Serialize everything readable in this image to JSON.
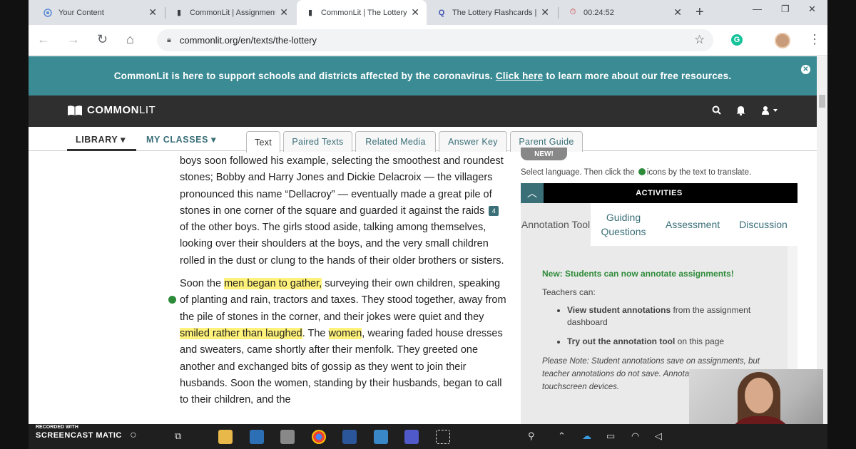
{
  "browser": {
    "tabs": [
      {
        "title": "Your Content",
        "icon": "circle-icon",
        "active": false
      },
      {
        "title": "CommonLit | Assignment",
        "icon": "book-icon",
        "active": false
      },
      {
        "title": "CommonLit | The Lottery",
        "icon": "book-icon",
        "active": true
      },
      {
        "title": "The Lottery Flashcards | Q",
        "icon": "quizlet-icon",
        "active": false
      },
      {
        "title": "00:24:52",
        "icon": "timer-icon",
        "active": false
      }
    ],
    "new_tab_glyph": "+",
    "url": "commonlit.org/en/texts/the-lottery"
  },
  "banner": {
    "before": "CommonLit is here to support schools and districts affected by the coronavirus.",
    "link": "Click here",
    "after": "to learn more about our free resources."
  },
  "header": {
    "logo_common": "COMMON",
    "logo_lit": "LIT"
  },
  "subnav": {
    "library": "LIBRARY",
    "my_classes": "MY CLASSES",
    "tabs": [
      "Text",
      "Paired Texts",
      "Related Media",
      "Answer Key",
      "Parent Guide"
    ]
  },
  "reading": {
    "p1_a": "boys soon followed his example, selecting the smoothest and roundest stones; Bobby and Harry Jones and Dickie Delacroix — the villagers pronounced this name “Dellacroy” — eventually made a great pile of stones in one corner of the square and guarded it against the raids",
    "p1_ref": "4",
    "p1_b": "of the other boys. The girls stood aside, talking among themselves, looking over their shoulders at the boys, and the very small children rolled in the dust or clung to the hands of their older brothers or sisters.",
    "p2_a": "Soon the",
    "p2_h1": "men began to gather,",
    "p2_b": "surveying their own children, speaking of planting and rain, tractors and taxes. They stood together, away from the pile of stones in the corner, and their jokes were quiet and they",
    "p2_h2": "smiled rather than laughed",
    "p2_c": ". The",
    "p2_h3": "women",
    "p2_d": ", wearing faded house dresses and sweaters, came shortly after their menfolk. They greeted one another and exchanged bits of gossip as they went to join their husbands. Soon the women, standing by their husbands, began to call to their children, and the"
  },
  "panel": {
    "new_badge": "NEW!",
    "lang_note_a": "Select language. Then click the",
    "lang_note_b": "icons by the text to translate.",
    "activities": "ACTIVITIES",
    "tabs": [
      "Annotation Tool",
      "Guiding Questions",
      "Assessment",
      "Discussion"
    ],
    "new_msg": "New: Students can now annotate assignments!",
    "teachers_can": "Teachers can:",
    "li1_bold": "View student annotations",
    "li1_rest": "from the assignment dashboard",
    "li2_bold": "Try out the annotation tool",
    "li2_rest": "on this page",
    "note": "Please Note: Student annotations save on assignments, but teacher annotations do not save. Annotat... be created on touchscreen devices."
  },
  "taskbar": {
    "recorded": "RECORDED WITH",
    "brand": "SCREENCAST MATIC"
  },
  "colors": {
    "banner": "#3a8b94",
    "header": "#2f2f2f",
    "accent": "#3a6f78",
    "highlight": "#fff27a",
    "green": "#2e8b3a"
  }
}
